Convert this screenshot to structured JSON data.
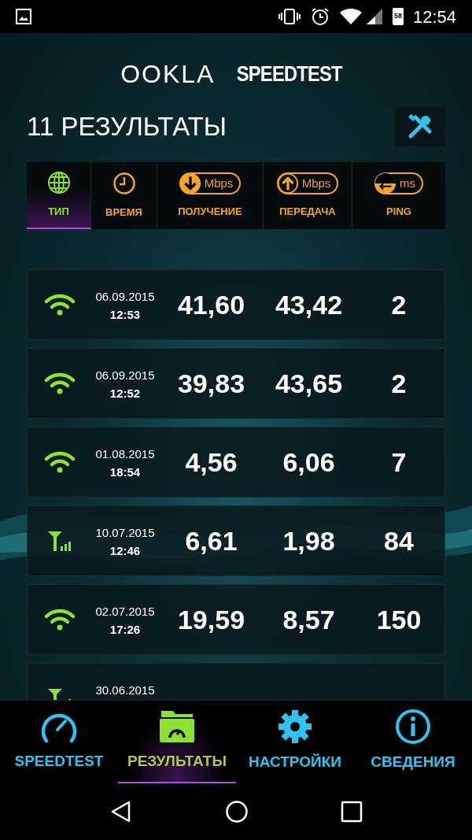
{
  "status_bar": {
    "battery": "58",
    "time": "12:54"
  },
  "logo": {
    "brand": "OOKLA",
    "product": "SPEEDTEST"
  },
  "title": "11 РЕЗУЛЬТАТЫ",
  "sort_tabs": [
    {
      "kind": "type",
      "label": "ТИП",
      "selected": true
    },
    {
      "kind": "time",
      "label": "ВРЕМЯ",
      "selected": false
    },
    {
      "kind": "download",
      "label": "ПОЛУЧЕНИЕ",
      "unit": "Mbps",
      "selected": false
    },
    {
      "kind": "upload",
      "label": "ПЕРЕДАЧА",
      "unit": "Mbps",
      "selected": false
    },
    {
      "kind": "ping",
      "label": "PING",
      "unit": "ms",
      "selected": false
    }
  ],
  "results": [
    {
      "kind": "wifi",
      "date": "06.09.2015",
      "time": "12:53",
      "download": "41,60",
      "upload": "43,42",
      "ping": "2"
    },
    {
      "kind": "wifi",
      "date": "06.09.2015",
      "time": "12:52",
      "download": "39,83",
      "upload": "43,65",
      "ping": "2"
    },
    {
      "kind": "wifi",
      "date": "01.08.2015",
      "time": "18:54",
      "download": "4,56",
      "upload": "6,06",
      "ping": "7"
    },
    {
      "kind": "cellular",
      "date": "10.07.2015",
      "time": "12:46",
      "download": "6,61",
      "upload": "1,98",
      "ping": "84"
    },
    {
      "kind": "wifi",
      "date": "02.07.2015",
      "time": "17:26",
      "download": "19,59",
      "upload": "8,57",
      "ping": "150"
    },
    {
      "kind": "cellular",
      "date": "30.06.2015"
    }
  ],
  "bottom_nav": [
    {
      "kind": "speedtest",
      "label": "SPEEDTEST",
      "selected": false
    },
    {
      "kind": "results",
      "label": "РЕЗУЛЬТАТЫ",
      "selected": true
    },
    {
      "kind": "settings",
      "label": "НАСТРОЙКИ",
      "selected": false
    },
    {
      "kind": "info",
      "label": "СВЕДЕНИЯ",
      "selected": false
    }
  ]
}
